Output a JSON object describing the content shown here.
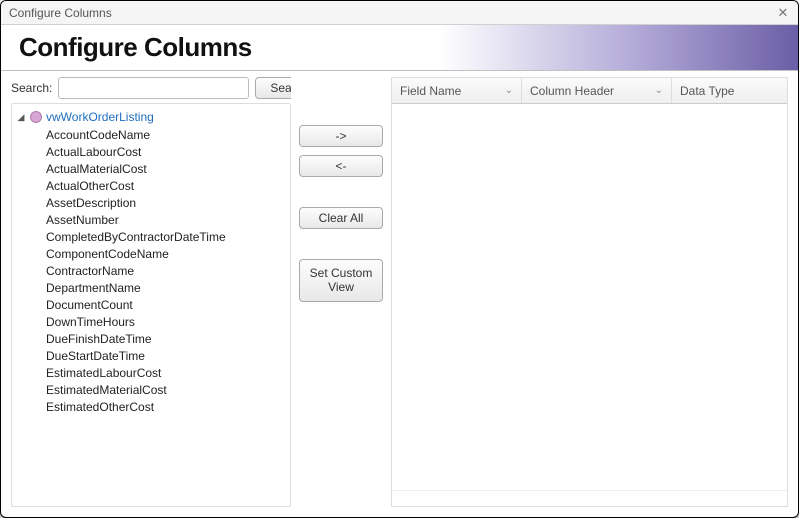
{
  "window": {
    "title": "Configure Columns"
  },
  "banner": {
    "title": "Configure Columns"
  },
  "search": {
    "label": "Search:",
    "value": "",
    "placeholder": "",
    "button_label": "Search"
  },
  "tree": {
    "root_label": "vwWorkOrderListing",
    "items": [
      "AccountCodeName",
      "ActualLabourCost",
      "ActualMaterialCost",
      "ActualOtherCost",
      "AssetDescription",
      "AssetNumber",
      "CompletedByContractorDateTime",
      "ComponentCodeName",
      "ContractorName",
      "DepartmentName",
      "DocumentCount",
      "DownTimeHours",
      "DueFinishDateTime",
      "DueStartDateTime",
      "EstimatedLabourCost",
      "EstimatedMaterialCost",
      "EstimatedOtherCost"
    ]
  },
  "buttons": {
    "add": "->",
    "remove": "<-",
    "clear_all": "Clear All",
    "set_custom_view": "Set Custom View"
  },
  "grid": {
    "columns": {
      "field_name": "Field Name",
      "column_header": "Column Header",
      "data_type": "Data Type"
    },
    "rows": []
  }
}
